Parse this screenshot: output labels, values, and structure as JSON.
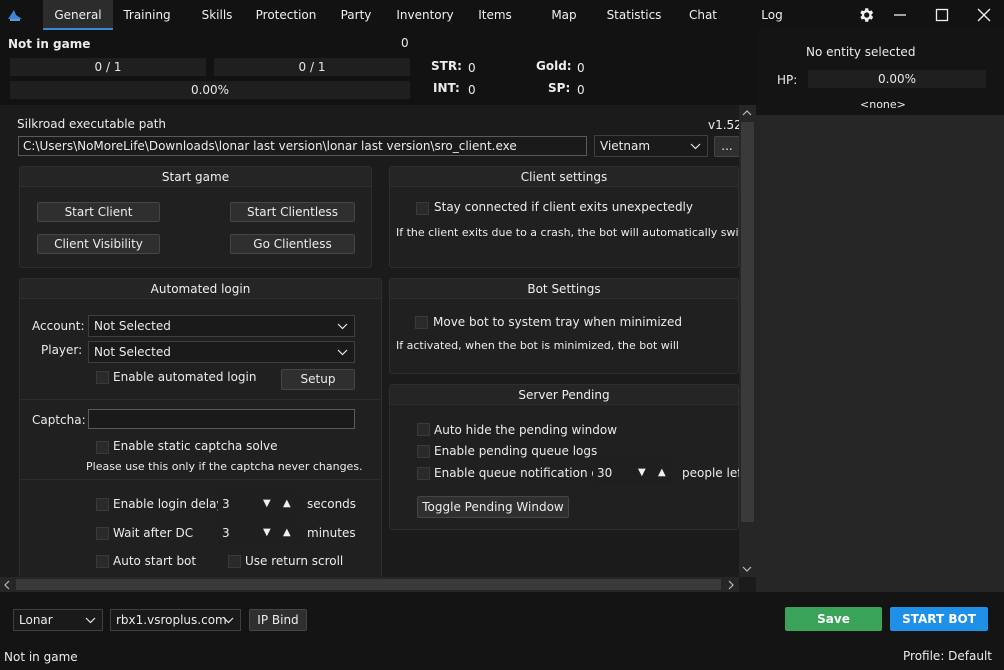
{
  "tabs": [
    {
      "label": "General",
      "active": true
    },
    {
      "label": "Training"
    },
    {
      "label": "Skills"
    },
    {
      "label": "Protection"
    },
    {
      "label": "Party"
    },
    {
      "label": "Inventory"
    },
    {
      "label": "Items"
    },
    {
      "label": "Map"
    },
    {
      "label": "Statistics"
    },
    {
      "label": "Chat"
    },
    {
      "label": "Log"
    }
  ],
  "icons": {
    "app": "app-logo-icon",
    "settings": "gear-icon",
    "minimize": "minimize-icon",
    "maximize": "maximize-icon",
    "close": "close-icon"
  },
  "info": {
    "status": "Not in game",
    "count": "0",
    "hp_bar": "0 / 1",
    "mp_bar": "0 / 1",
    "exp_bar": "0.00%",
    "str_label": "STR:",
    "str_value": "0",
    "int_label": "INT:",
    "int_value": "0",
    "gold_label": "Gold:",
    "gold_value": "0",
    "sp_label": "SP:",
    "sp_value": "0"
  },
  "entity": {
    "title": "No entity selected",
    "hp_label": "HP:",
    "hp_value": "0.00%",
    "name": "<none>"
  },
  "path": {
    "label": "Silkroad  executable path",
    "version": "v1.52",
    "value": "C:\\Users\\NoMoreLife\\Downloads\\lonar last version\\lonar last version\\sro_client.exe",
    "region": "Vietnam",
    "browse": "..."
  },
  "start_game": {
    "title": "Start game",
    "start_client": "Start Client",
    "start_clientless": "Start Clientless",
    "client_visibility": "Client Visibility",
    "go_clientless": "Go Clientless"
  },
  "client_settings": {
    "title": "Client settings",
    "stay_connected": "Stay connected if client exits unexpectedly",
    "description": "If the client exits due to a crash, the bot will automatically switch"
  },
  "auto_login": {
    "title": "Automated login",
    "account_label": "Account:",
    "account_value": "Not Selected",
    "player_label": "Player:",
    "player_value": "Not Selected",
    "enable_auto_login": "Enable automated login",
    "setup": "Setup",
    "captcha_label": "Captcha:",
    "captcha_value": "",
    "static_captcha": "Enable static captcha solve",
    "captcha_note": "Please use this only if the captcha never changes.",
    "login_delay": "Enable login delay",
    "login_delay_value": "3",
    "seconds": "seconds",
    "wait_after_dc": "Wait after DC",
    "wait_after_dc_value": "3",
    "minutes": "minutes",
    "auto_start_bot": "Auto start bot",
    "use_return_scroll": "Use return scroll"
  },
  "bot_settings": {
    "title": "Bot Settings",
    "move_tray": "Move bot to system tray when minimized",
    "description": "If activated, when the bot is minimized, the bot will"
  },
  "server_pending": {
    "title": "Server Pending",
    "auto_hide": "Auto hide the pending window",
    "enable_logs": "Enable pending queue logs",
    "enable_notification": "Enable queue notification on",
    "notification_value": "30",
    "people_left": "people left",
    "toggle": "Toggle Pending Window"
  },
  "bottom": {
    "profile_select": "Lonar",
    "server_select": "rbx1.vsroplus.com",
    "ip_bind": "IP Bind",
    "save": "Save",
    "start_bot": "START BOT",
    "status": "Not in game",
    "profile": "Profile: Default"
  },
  "colors": {
    "accent": "#1e90e8",
    "save": "#3aa35a"
  }
}
